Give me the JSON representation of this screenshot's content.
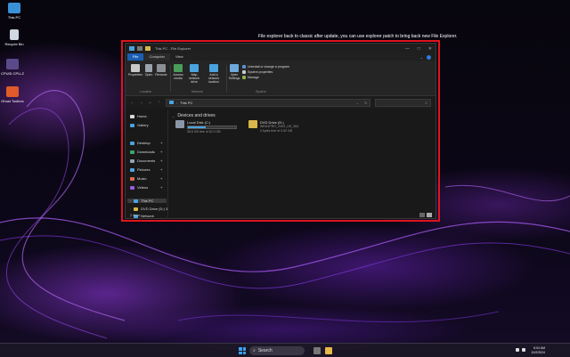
{
  "annotation": "File explorer back to classic after update, you can use explorer patch to bring back new File Explorer.",
  "desktop_icons": [
    {
      "label": "This PC",
      "icon": "monitor-icon"
    },
    {
      "label": "Recycle Bin",
      "icon": "recycle-bin-icon"
    },
    {
      "label": "CPUID CPU-Z",
      "icon": "cpu-z-icon"
    },
    {
      "label": "Ghost Toolbox",
      "icon": "ghost-icon"
    }
  ],
  "window": {
    "title": "This PC - File Explorer",
    "controls": [
      "—",
      "□",
      "✕"
    ]
  },
  "tabs": {
    "file": "File",
    "computer": "Computer",
    "view": "View"
  },
  "ribbon": {
    "location": {
      "label": "Location",
      "properties": "Properties",
      "open": "Open",
      "rename": "Rename"
    },
    "network": {
      "label": "Network",
      "access_media": "Access media",
      "map_drive": "Map network drive",
      "add_location": "Add a network location"
    },
    "system": {
      "label": "System",
      "open_settings": "Open Settings",
      "uninstall": "Uninstall or change a program",
      "system_properties": "System properties",
      "manage": "Manage"
    }
  },
  "address": {
    "path": "This PC",
    "search_placeholder": ""
  },
  "sidebar": {
    "items": [
      {
        "label": "Home",
        "icon": "home-icon"
      },
      {
        "label": "Gallery",
        "icon": "gallery-icon"
      },
      {
        "label": "Desktop",
        "icon": "desktop-folder-icon"
      },
      {
        "label": "Downloads",
        "icon": "downloads-icon"
      },
      {
        "label": "Documents",
        "icon": "documents-icon"
      },
      {
        "label": "Pictures",
        "icon": "pictures-icon"
      },
      {
        "label": "Music",
        "icon": "music-icon"
      },
      {
        "label": "Videos",
        "icon": "videos-icon"
      },
      {
        "label": "This PC",
        "icon": "this-pc-icon"
      },
      {
        "label": "DVD Drive (D:) 3",
        "icon": "dvd-icon"
      },
      {
        "label": "Network",
        "icon": "network-icon"
      }
    ],
    "status": "2 items"
  },
  "content": {
    "section": "Devices and drives",
    "drives": [
      {
        "name": "Local Disk (C:)",
        "free": "38.8 GB free of 62.0 GB",
        "used_fraction": 0.37
      },
      {
        "name": "DVD Drive (D:)",
        "label": "WIN11PRO_24H2_US_X64",
        "free": "0 bytes free of 3.92 GB"
      }
    ]
  },
  "taskbar": {
    "search": "Search",
    "time": "6:04 AM",
    "date": "10/2/2024"
  }
}
